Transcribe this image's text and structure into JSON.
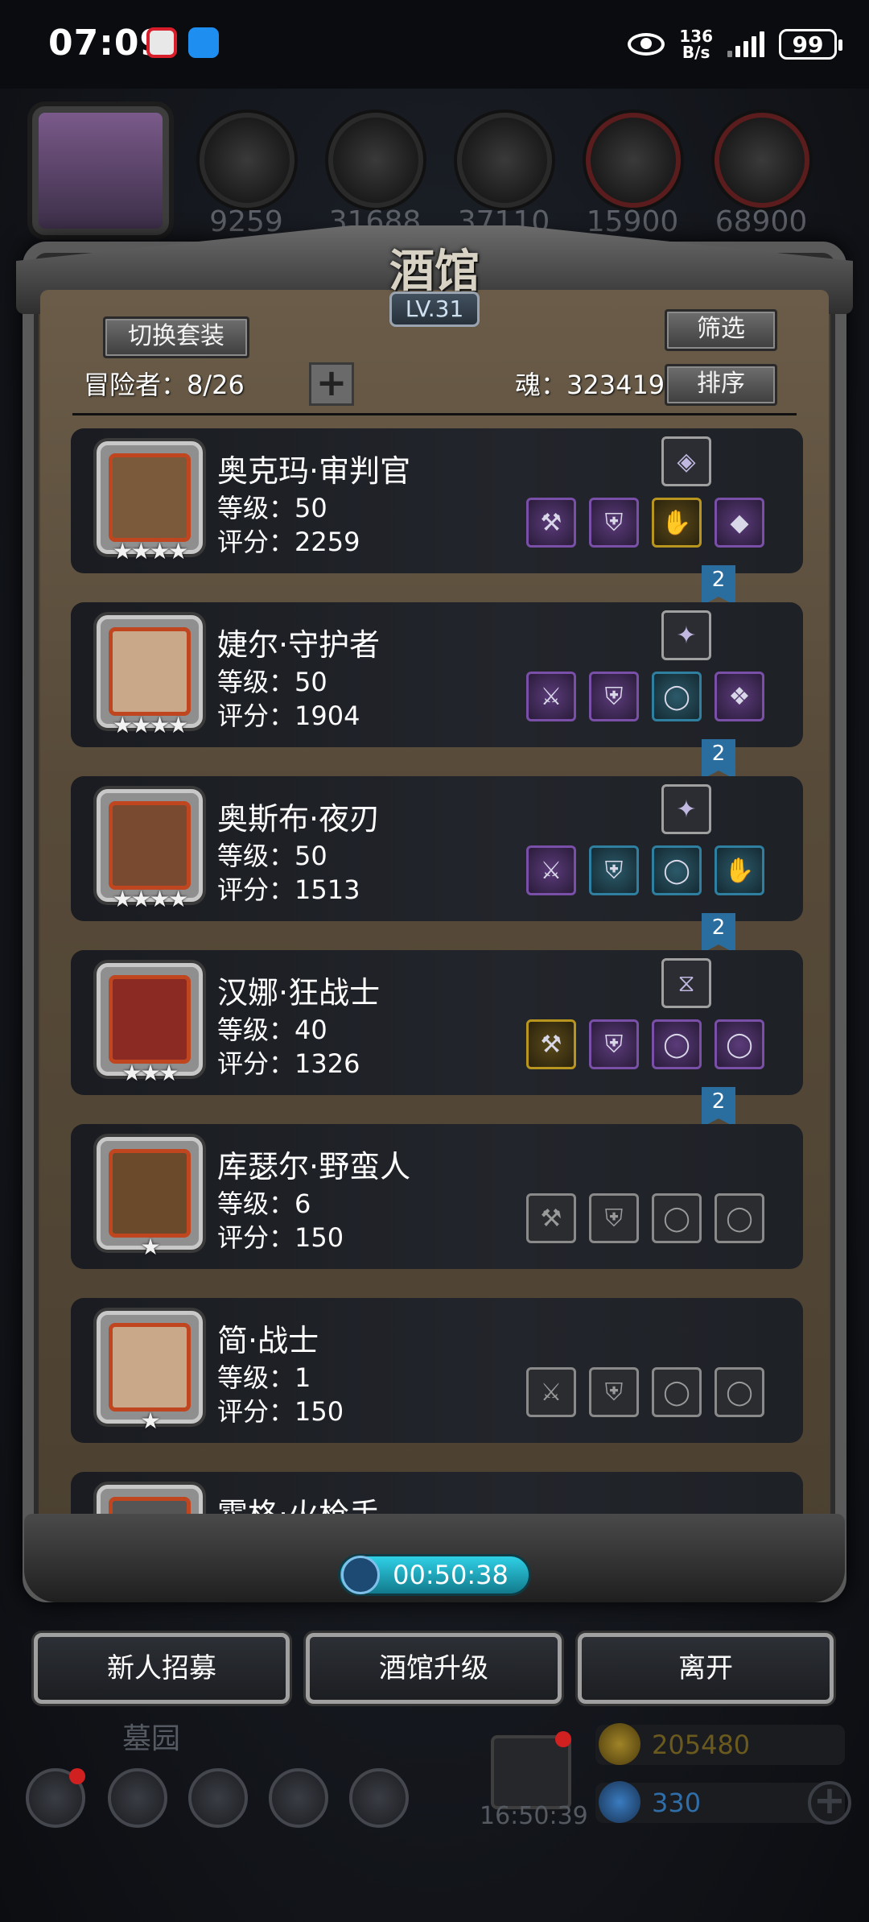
{
  "status_bar": {
    "time": "07:09",
    "net_speed_value": "136",
    "net_speed_unit": "B/s",
    "battery": "99"
  },
  "resources": [
    "9259",
    "31688",
    "37110",
    "15900",
    "68900"
  ],
  "panel": {
    "title": "酒馆",
    "level": "LV.31",
    "switch_outfit_label": "切换套装",
    "filter_label": "筛选",
    "sort_label": "排序",
    "adventurers_label": "冒险者：8/26",
    "add_label": "+",
    "soul_label": "魂：323419"
  },
  "heroes": [
    {
      "name": "奥克玛·审判官",
      "level": "等级：50",
      "score": "评分：2259",
      "stars": "★★★★",
      "ribbon": "2",
      "relic": "◈",
      "equip": [
        {
          "icon": "⚒",
          "tier": "purple"
        },
        {
          "icon": "⛨",
          "tier": "purple"
        },
        {
          "icon": "✋",
          "tier": "gold"
        },
        {
          "icon": "◆",
          "tier": "purple"
        }
      ]
    },
    {
      "name": "婕尔·守护者",
      "level": "等级：50",
      "score": "评分：1904",
      "stars": "★★★★",
      "ribbon": "2",
      "relic": "✦",
      "equip": [
        {
          "icon": "⚔",
          "tier": "purple"
        },
        {
          "icon": "⛨",
          "tier": "purple"
        },
        {
          "icon": "◯",
          "tier": "blue"
        },
        {
          "icon": "❖",
          "tier": "purple"
        }
      ]
    },
    {
      "name": "奥斯布·夜刃",
      "level": "等级：50",
      "score": "评分：1513",
      "stars": "★★★★",
      "ribbon": "2",
      "relic": "✦",
      "equip": [
        {
          "icon": "⚔",
          "tier": "purple"
        },
        {
          "icon": "⛨",
          "tier": "blue"
        },
        {
          "icon": "◯",
          "tier": "blue"
        },
        {
          "icon": "✋",
          "tier": "blue"
        }
      ]
    },
    {
      "name": "汉娜·狂战士",
      "level": "等级：40",
      "score": "评分：1326",
      "stars": "★★★",
      "ribbon": "2",
      "relic": "⧖",
      "equip": [
        {
          "icon": "⚒",
          "tier": "gold"
        },
        {
          "icon": "⛨",
          "tier": "purple"
        },
        {
          "icon": "◯",
          "tier": "purple"
        },
        {
          "icon": "◯",
          "tier": "purple"
        }
      ]
    },
    {
      "name": "库瑟尔·野蛮人",
      "level": "等级：6",
      "score": "评分：150",
      "stars": "★",
      "ribbon": "",
      "relic": "",
      "equip": [
        {
          "icon": "⚒",
          "tier": "empty"
        },
        {
          "icon": "⛨",
          "tier": "empty"
        },
        {
          "icon": "◯",
          "tier": "empty"
        },
        {
          "icon": "◯",
          "tier": "empty"
        }
      ]
    },
    {
      "name": "简·战士",
      "level": "等级：1",
      "score": "评分：150",
      "stars": "★",
      "ribbon": "",
      "relic": "",
      "equip": [
        {
          "icon": "⚔",
          "tier": "empty"
        },
        {
          "icon": "⛨",
          "tier": "empty"
        },
        {
          "icon": "◯",
          "tier": "empty"
        },
        {
          "icon": "◯",
          "tier": "empty"
        }
      ]
    },
    {
      "name": "霍格·火枪手",
      "level": "",
      "score": "",
      "stars": "",
      "ribbon": "",
      "relic": "",
      "equip": []
    }
  ],
  "timer": "00:50:38",
  "actions": {
    "recruit": "新人招募",
    "upgrade": "酒馆升级",
    "leave": "离开"
  },
  "hud": {
    "area_name": "墓园",
    "gift_timer": "16:50:39",
    "gold": "205480",
    "gems": "330",
    "add": "+"
  },
  "colors": {
    "panel_bg": "#574a39",
    "card_bg": "#1f2227",
    "epic_border": "#7a4fa8",
    "rare_border": "#2f7fa0",
    "legend_border": "#b8951e",
    "timer_fill": "#2fd0e6",
    "gold_text": "#6b5a1e",
    "gem_text": "#2f6ea8"
  }
}
